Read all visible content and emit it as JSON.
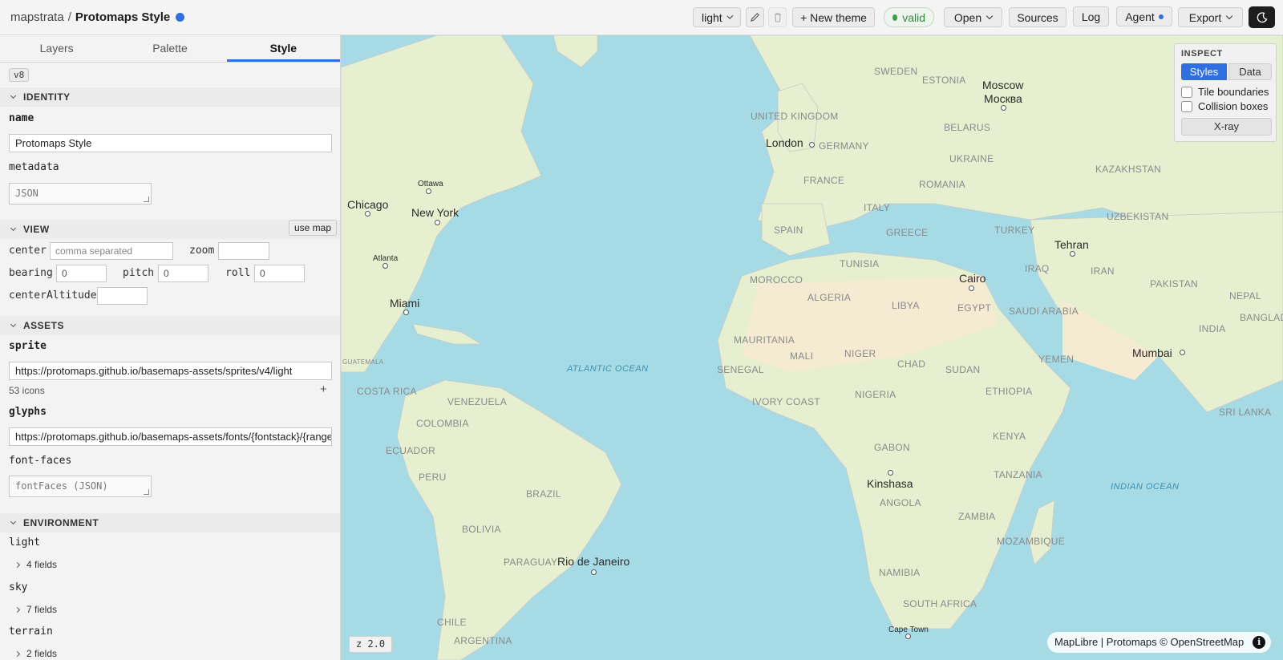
{
  "topbar": {
    "app": "mapstrata",
    "separator": "/",
    "project": "Protomaps Style",
    "theme_select": "light",
    "new_theme": "+ New theme",
    "valid": "valid",
    "open": "Open",
    "sources": "Sources",
    "log": "Log",
    "agent": "Agent",
    "export": "Export"
  },
  "tabs": {
    "layers": "Layers",
    "palette": "Palette",
    "style": "Style"
  },
  "version": "v8",
  "identity": {
    "title": "IDENTITY",
    "name_label": "name",
    "name_value": "Protomaps Style",
    "metadata_label": "metadata",
    "metadata_placeholder": "JSON"
  },
  "view": {
    "title": "VIEW",
    "use_map": "use map",
    "center_label": "center",
    "center_placeholder": "comma separated",
    "zoom_label": "zoom",
    "bearing_label": "bearing",
    "bearing_value": "0",
    "pitch_label": "pitch",
    "pitch_value": "0",
    "roll_label": "roll",
    "roll_value": "0",
    "altitude_label": "centerAltitude"
  },
  "assets": {
    "title": "ASSETS",
    "sprite_label": "sprite",
    "sprite_value": "https://protomaps.github.io/basemaps-assets/sprites/v4/light",
    "icons_count": "53 icons",
    "add": "+",
    "glyphs_label": "glyphs",
    "glyphs_value": "https://protomaps.github.io/basemaps-assets/fonts/{fontstack}/{range}.pbf",
    "fontfaces_label": "font-faces",
    "fontfaces_placeholder": "fontFaces (JSON)"
  },
  "environment": {
    "title": "ENVIRONMENT",
    "light_label": "light",
    "light_fields": "4 fields",
    "sky_label": "sky",
    "sky_fields": "7 fields",
    "terrain_label": "terrain",
    "terrain_fields": "2 fields"
  },
  "inspect": {
    "title": "INSPECT",
    "styles": "Styles",
    "data": "Data",
    "tile_boundaries": "Tile boundaries",
    "collision_boxes": "Collision boxes",
    "xray": "X-ray"
  },
  "map": {
    "zoom": "z 2.0",
    "attribution": "MapLibre | Protomaps © OpenStreetMap",
    "info": "i",
    "cities": [
      "Moscow",
      "Москва",
      "London",
      "Chicago",
      "Ottawa",
      "New York",
      "Atlanta",
      "Miami",
      "Tehran",
      "Cairo",
      "Mumbai",
      "Kinshasa",
      "Rio de Janeiro",
      "Cape Town"
    ],
    "countries": [
      "SWEDEN",
      "ESTONIA",
      "UNITED KINGDOM",
      "BELARUS",
      "GERMANY",
      "UKRAINE",
      "KAZAKHSTAN",
      "FRANCE",
      "ROMANIA",
      "ITALY",
      "UZBEKISTAN",
      "SPAIN",
      "GREECE",
      "TURKEY",
      "TUNISIA",
      "IRAQ",
      "IRAN",
      "MOROCCO",
      "PAKISTAN",
      "NEPAL",
      "ALGERIA",
      "LIBYA",
      "EGYPT",
      "SAUDI ARABIA",
      "BANGLADESH",
      "INDIA",
      "MAURITANIA",
      "MALI",
      "NIGER",
      "CHAD",
      "SUDAN",
      "YEMEN",
      "SENEGAL",
      "GUATEMALA",
      "COSTA RICA",
      "VENEZUELA",
      "IVORY COAST",
      "NIGERIA",
      "ETHIOPIA",
      "SRI LANKA",
      "COLOMBIA",
      "ECUADOR",
      "GABON",
      "KENYA",
      "PERU",
      "BRAZIL",
      "TANZANIA",
      "ANGOLA",
      "ZAMBIA",
      "BOLIVIA",
      "MOZAMBIQUE",
      "PARAGUAY",
      "NAMIBIA",
      "SOUTH AFRICA",
      "CHILE",
      "ARGENTINA"
    ],
    "oceans": [
      "ATLANTIC OCEAN",
      "INDIAN OCEAN"
    ]
  }
}
